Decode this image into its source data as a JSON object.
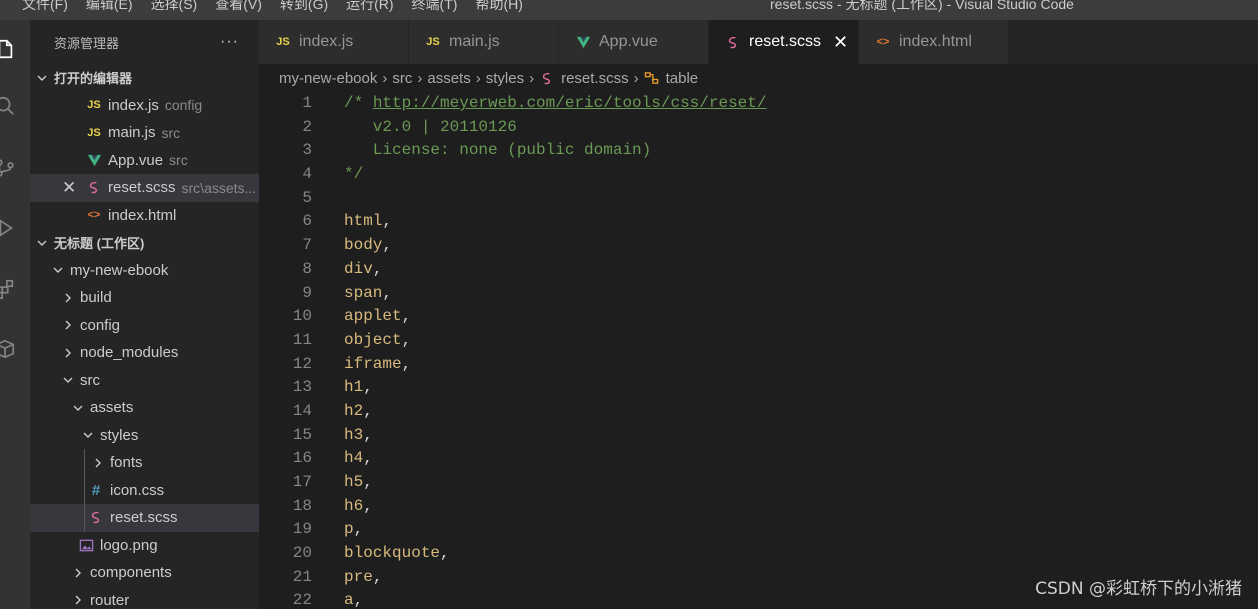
{
  "menu": [
    "文件(F)",
    "编辑(E)",
    "选择(S)",
    "查看(V)",
    "转到(G)",
    "运行(R)",
    "终端(T)",
    "帮助(H)"
  ],
  "window_title": "reset.scss - 无标题 (工作区) - Visual Studio Code",
  "sidebar": {
    "title": "资源管理器",
    "more": "···",
    "open_editors_label": "打开的编辑器",
    "open_editors": [
      {
        "name": "index.js",
        "desc": "config",
        "icon": "js-icon"
      },
      {
        "name": "main.js",
        "desc": "src",
        "icon": "js-icon"
      },
      {
        "name": "App.vue",
        "desc": "src",
        "icon": "vue-icon"
      },
      {
        "name": "reset.scss",
        "desc": "src\\assets...",
        "icon": "sass-icon"
      },
      {
        "name": "index.html",
        "desc": "",
        "icon": "html-icon"
      }
    ],
    "close_glyph": "✕",
    "workspace_label": "无标题 (工作区)",
    "tree": {
      "project": "my-new-ebook",
      "build": "build",
      "config": "config",
      "node_modules": "node_modules",
      "src": "src",
      "assets": "assets",
      "styles": "styles",
      "fonts": "fonts",
      "icon_css": "icon.css",
      "reset_scss": "reset.scss",
      "logo_png": "logo.png",
      "components": "components",
      "router": "router"
    }
  },
  "tabs": [
    {
      "label": "index.js",
      "icon": "js-icon"
    },
    {
      "label": "main.js",
      "icon": "js-icon"
    },
    {
      "label": "App.vue",
      "icon": "vue-icon"
    },
    {
      "label": "reset.scss",
      "icon": "sass-icon",
      "active": true
    },
    {
      "label": "index.html",
      "icon": "html-icon"
    }
  ],
  "tab_close": "✕",
  "icon_text": {
    "js": "JS",
    "html": "<>",
    "css": "#"
  },
  "breadcrumb": [
    "my-new-ebook",
    "src",
    "assets",
    "styles",
    "reset.scss",
    "table"
  ],
  "code": {
    "url": "http://meyerweb.com/eric/tools/css/reset/",
    "comment_open": "/* ",
    "line2": "   v2.0 | 20110126",
    "line3": "   License: none (public domain)",
    "line4": "*/",
    "selectors": [
      "html",
      "body",
      "div",
      "span",
      "applet",
      "object",
      "iframe",
      "h1",
      "h2",
      "h3",
      "h4",
      "h5",
      "h6",
      "p",
      "blockquote",
      "pre",
      "a"
    ],
    "line_numbers": [
      "1",
      "2",
      "3",
      "4",
      "5",
      "6",
      "7",
      "8",
      "9",
      "10",
      "11",
      "12",
      "13",
      "14",
      "15",
      "16",
      "17",
      "18",
      "19",
      "20",
      "21",
      "22"
    ]
  },
  "watermark": "CSDN @彩虹桥下的小淅猪",
  "colors": {
    "js": "#e8d44d",
    "vue": "#41b883",
    "sass": "#e06c9b",
    "html": "#e37933",
    "css": "#519aba",
    "image": "#a074c4"
  }
}
